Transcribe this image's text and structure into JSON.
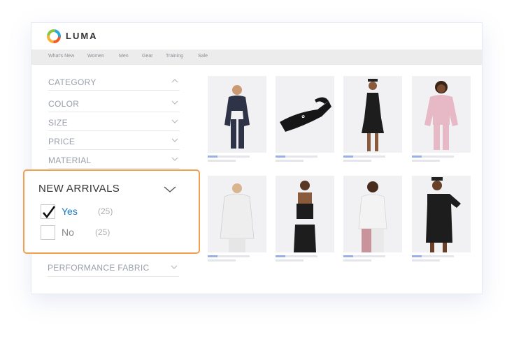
{
  "header": {
    "brand": "LUMA"
  },
  "nav": {
    "items": [
      "What's New",
      "Women",
      "Men",
      "Gear",
      "Training",
      "Sale"
    ]
  },
  "filters": {
    "items": [
      "CATEGORY",
      "COLOR",
      "SIZE",
      "PRICE",
      "MATERIAL"
    ],
    "bottom_item": "PERFORMANCE FABRIC"
  },
  "popout": {
    "title": "NEW ARRIVALS",
    "options": [
      {
        "label": "Yes",
        "count": "(25)",
        "checked": true
      },
      {
        "label": "No",
        "count": "(25)",
        "checked": false
      }
    ]
  },
  "colors": {
    "accent_orange": "#f0a050",
    "link_blue": "#1979c3",
    "muted_text": "#9aa0aa"
  }
}
